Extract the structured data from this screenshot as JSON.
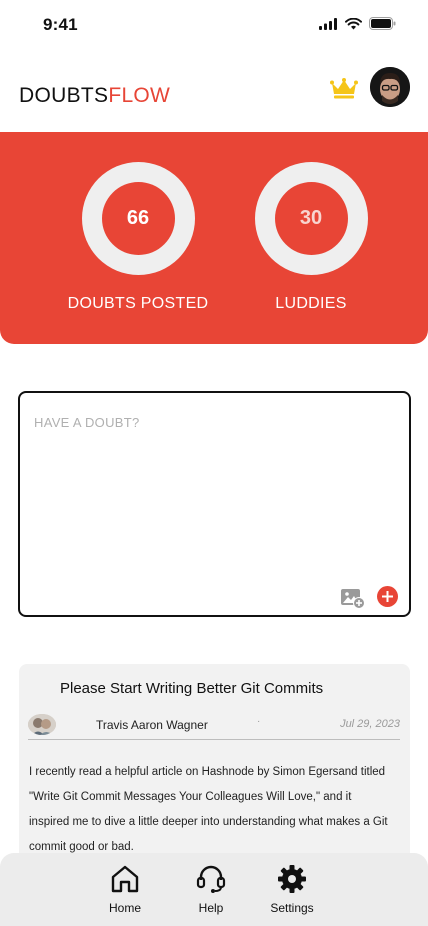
{
  "status_bar": {
    "time": "9:41"
  },
  "header": {
    "logo_part1": "DOUBTS",
    "logo_part2": "FLOW",
    "icons": [
      "crown-icon",
      "avatar"
    ]
  },
  "stats": [
    {
      "value": "66",
      "label": "DOUBTS POSTED"
    },
    {
      "value": "30",
      "label": "LUDDIES"
    }
  ],
  "doubt_input": {
    "placeholder": "HAVE A DOUBT?",
    "value": "",
    "icons": [
      "add-image-icon",
      "plus-icon"
    ]
  },
  "article": {
    "title": "Please Start Writing Better Git Commits",
    "author": "Travis Aaron Wagner",
    "separator": "·",
    "date": "Jul 29, 2023",
    "body": "I recently read a helpful article on Hashnode by Simon Egersand titled \"Write Git Commit Messages Your Colleagues Will Love,\" and it inspired me to dive a little deeper into understanding what makes a Git commit good or bad."
  },
  "nav": {
    "items": [
      {
        "label": "Home",
        "icon": "home-icon"
      },
      {
        "label": "Help",
        "icon": "headset-icon"
      },
      {
        "label": "Settings",
        "icon": "gear-icon"
      }
    ]
  },
  "colors": {
    "accent": "#e84536",
    "ring": "#efefef",
    "crown": "#f5c518",
    "card_bg": "#f2f2f2",
    "nav_bg": "#ececec"
  }
}
